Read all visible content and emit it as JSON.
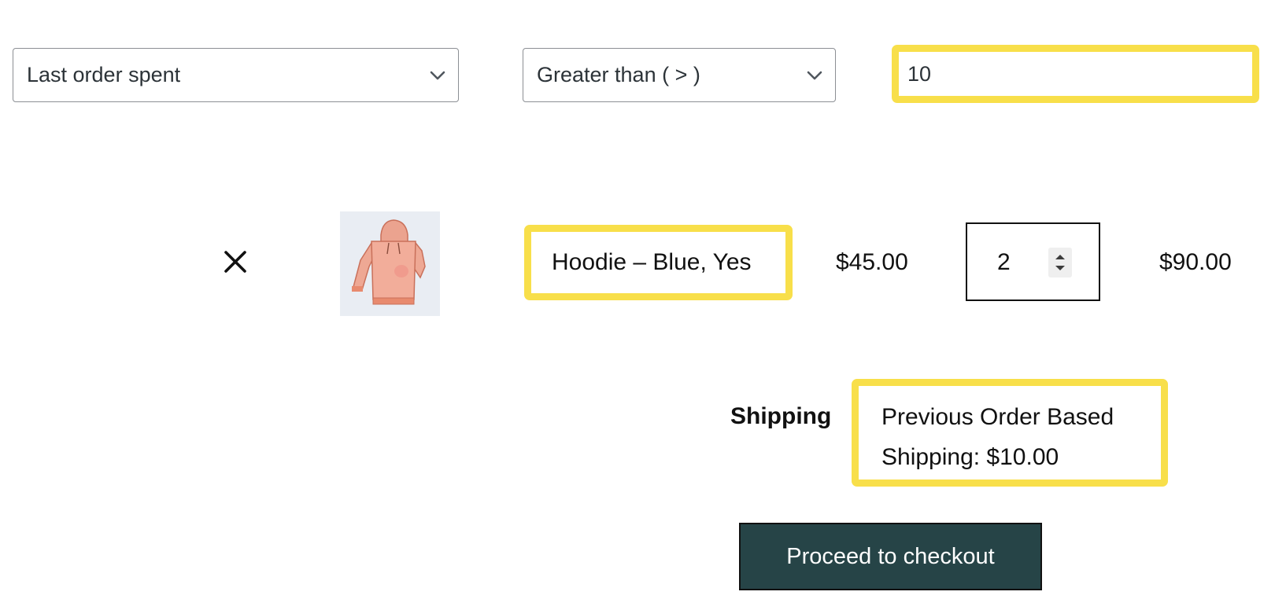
{
  "rule": {
    "condition_select": {
      "selected": "Last order spent",
      "icon": "chevron-down-icon"
    },
    "operator_select": {
      "selected": "Greater than ( > )",
      "icon": "chevron-down-icon"
    },
    "value_input": {
      "value": "10"
    },
    "highlight_color": "#f8df4a"
  },
  "cart": {
    "items": [
      {
        "remove_icon": "close-icon",
        "thumbnail_icon": "hoodie-icon",
        "name": "Hoodie – Blue, Yes",
        "price": "$45.00",
        "quantity": "2",
        "subtotal": "$90.00"
      }
    ]
  },
  "totals": {
    "shipping_label": "Shipping",
    "shipping_method_line1": "Previous Order Based",
    "shipping_method_line2": "Shipping: $10.00"
  },
  "checkout": {
    "button_label": "Proceed to checkout",
    "button_color": "#264447"
  }
}
